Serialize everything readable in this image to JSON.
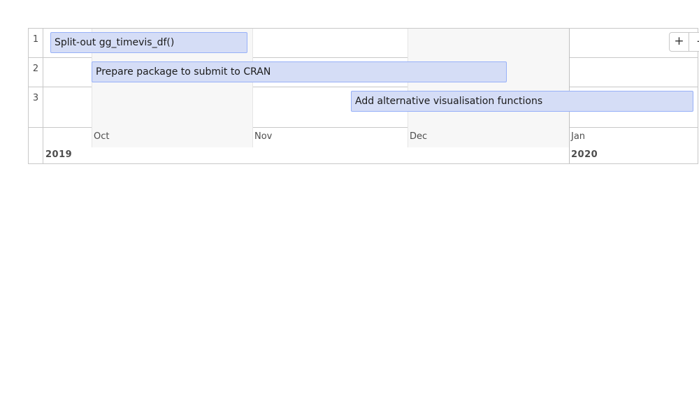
{
  "groups": [
    {
      "label": "1"
    },
    {
      "label": "2"
    },
    {
      "label": "3"
    }
  ],
  "items": [
    {
      "content": "Split-out gg_timevis_df()",
      "group": "1"
    },
    {
      "content": "Prepare package to submit to CRAN",
      "group": "2"
    },
    {
      "content": "Add alternative visualisation functions",
      "group": "3"
    }
  ],
  "axis": {
    "minor": [
      "Oct",
      "Nov",
      "Dec",
      "Jan"
    ],
    "major": [
      "2019",
      "2020"
    ]
  },
  "zoom": {
    "in_label": "+",
    "out_label": "-"
  },
  "colors": {
    "item_fill": "#d5ddf6",
    "item_border": "#97b0f8",
    "weekend_shade": "#f7f7f7"
  }
}
